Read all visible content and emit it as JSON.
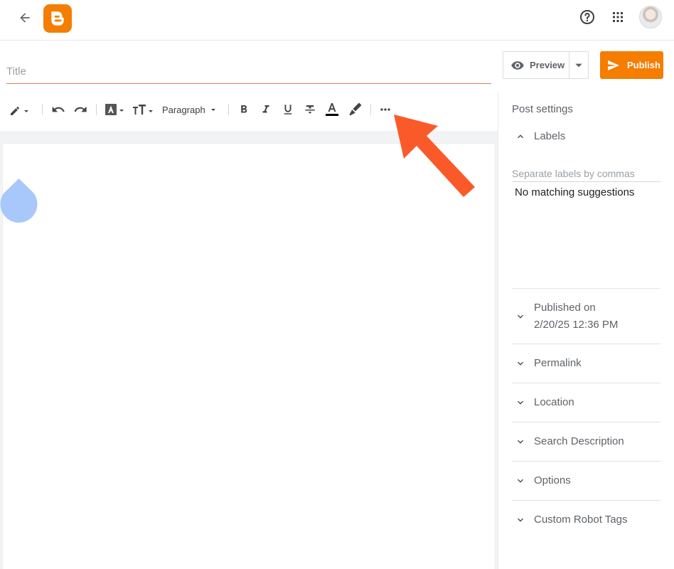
{
  "header": {
    "back_icon": "arrow-left-icon",
    "logo_icon": "blogger-logo-icon",
    "help_icon": "help-circle-icon",
    "apps_icon": "apps-grid-icon",
    "avatar_icon": "user-avatar"
  },
  "post": {
    "title_placeholder": "Title"
  },
  "actions": {
    "preview_label": "Preview",
    "publish_label": "Publish"
  },
  "toolbar": {
    "paragraph_label": "Paragraph",
    "icons": [
      "pencil-icon",
      "undo-icon",
      "redo-icon",
      "text-color-box-icon",
      "font-size-icon",
      "bold-icon",
      "italic-icon",
      "underline-icon",
      "strikethrough-icon",
      "text-color-icon",
      "highlighter-icon",
      "more-options-icon"
    ]
  },
  "sidebar": {
    "post_settings_title": "Post settings",
    "labels": {
      "label": "Labels",
      "placeholder": "Separate labels by commas",
      "suggestion_text": "No matching suggestions"
    },
    "published_on": {
      "label": "Published on",
      "value": "2/20/25 12:36 PM"
    },
    "sections": [
      {
        "label": "Permalink"
      },
      {
        "label": "Location"
      },
      {
        "label": "Search Description"
      },
      {
        "label": "Options"
      },
      {
        "label": "Custom Robot Tags"
      }
    ]
  },
  "colors": {
    "brand": "#f57d00",
    "annotation_arrow": "#fa5a2a",
    "drop_handle": "#a8c7fa",
    "title_underline": "#e27c5a"
  }
}
